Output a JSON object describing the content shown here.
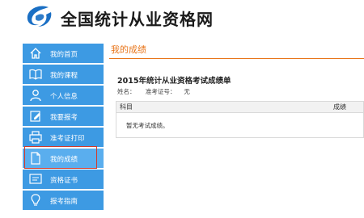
{
  "header": {
    "site_title": "全国统计从业资格网",
    "logo_icon": "site-logo-icon",
    "brand_color": "#1a6fc4"
  },
  "sidebar": {
    "accent": "#3d9ae3",
    "active_outline": "#d43a2a",
    "items": [
      {
        "label": "我的首页",
        "icon": "home-icon",
        "active": false
      },
      {
        "label": "我的课程",
        "icon": "book-icon",
        "active": false
      },
      {
        "label": "个人信息",
        "icon": "user-icon",
        "active": false
      },
      {
        "label": "我要报考",
        "icon": "edit-icon",
        "active": false
      },
      {
        "label": "准考证打印",
        "icon": "printer-icon",
        "active": false
      },
      {
        "label": "我的成绩",
        "icon": "document-icon",
        "active": true
      },
      {
        "label": "资格证书",
        "icon": "certificate-icon",
        "active": false
      },
      {
        "label": "报考指南",
        "icon": "lightbulb-icon",
        "active": false
      }
    ]
  },
  "main": {
    "tab_title": "我的成绩",
    "tab_color": "#e8751a",
    "report_title": "2015年统计从业资格考试成绩单",
    "name_label": "姓名：",
    "ticket_label": "准考证号：",
    "ticket_value": "无",
    "table": {
      "col_subject": "科目",
      "col_score": "成绩",
      "empty_text": "暂无考试成绩。"
    }
  }
}
